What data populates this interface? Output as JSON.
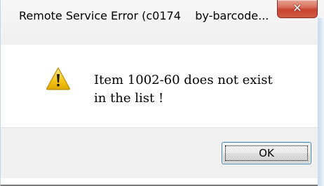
{
  "window": {
    "title": "Remote Service Error (c0174    by-barcode...",
    "close_icon": "close-icon",
    "close_glyph": "✕"
  },
  "message": {
    "icon": "warning-icon",
    "line1": "Item 1002-60 does not exist",
    "line2": "in the list !"
  },
  "buttons": {
    "ok_label": "OK"
  },
  "colors": {
    "close_button": "#c8452e",
    "footer_bg": "#f0f0f0",
    "warning_yellow": "#f5c518",
    "button_border": "#3c7fb1"
  }
}
